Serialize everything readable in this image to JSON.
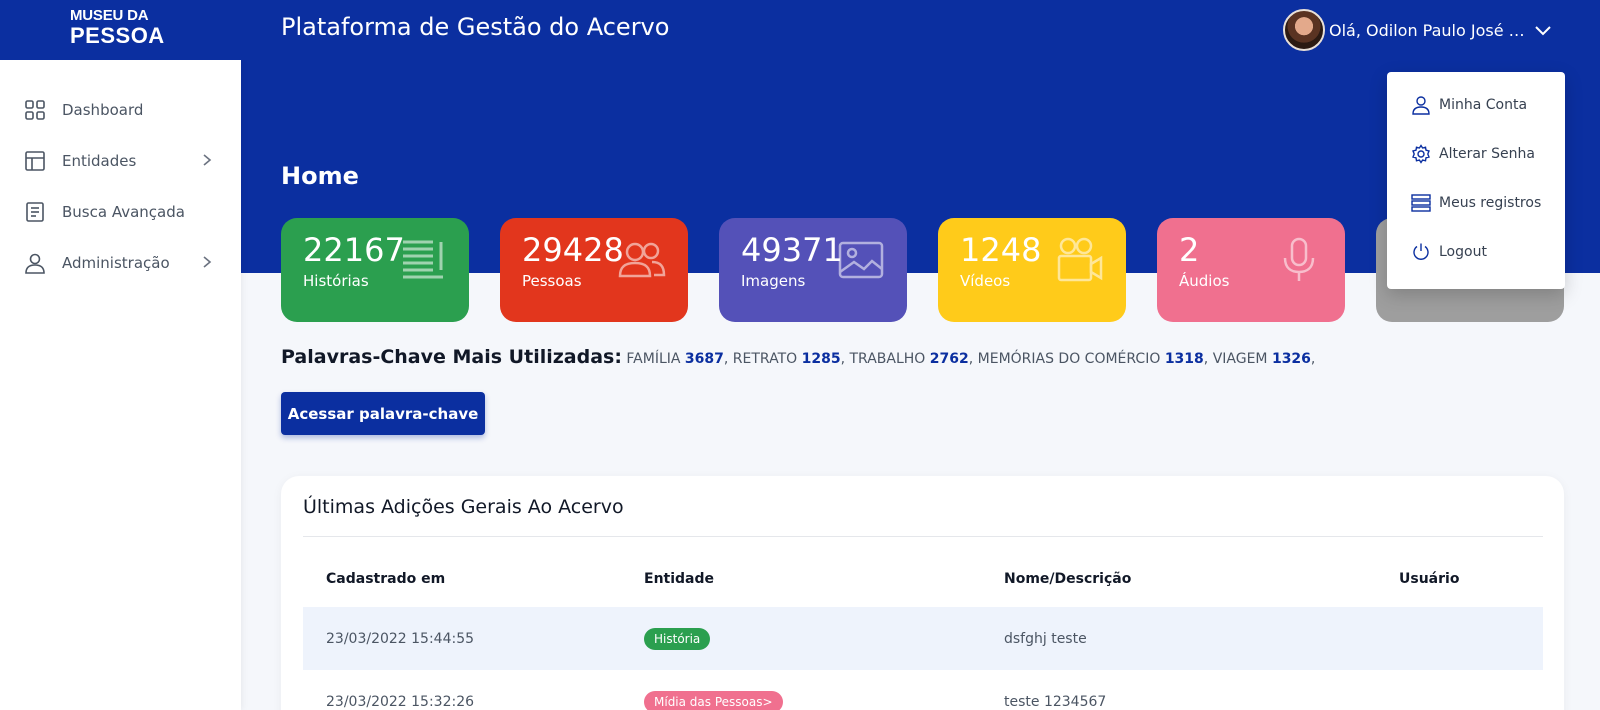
{
  "header": {
    "logo_line1": "MUSEU DA",
    "logo_line2": "PESSOA",
    "app_title": "Plataforma de Gestão do Acervo",
    "user_greeting": "Olá, Odilon Paulo José M..."
  },
  "sidebar": {
    "items": [
      {
        "label": "Dashboard",
        "icon": "grid-icon"
      },
      {
        "label": "Entidades",
        "icon": "layout-icon"
      },
      {
        "label": "Busca Avançada",
        "icon": "document-icon"
      },
      {
        "label": "Administração",
        "icon": "user-icon"
      }
    ]
  },
  "page": {
    "title": "Home"
  },
  "stats": [
    {
      "value": "22167",
      "label": "Histórias",
      "color": "#2b9f4f",
      "icon": "text-lines-icon"
    },
    {
      "value": "29428",
      "label": "Pessoas",
      "color": "#e2361d",
      "icon": "people-icon"
    },
    {
      "value": "49371",
      "label": "Imagens",
      "color": "#5451b8",
      "icon": "image-icon"
    },
    {
      "value": "1248",
      "label": "Vídeos",
      "color": "#ffcb1a",
      "icon": "video-camera-icon"
    },
    {
      "value": "2",
      "label": "Áudios",
      "color": "#f0708f",
      "icon": "microphone-icon"
    },
    {
      "value": "",
      "label": "",
      "color": "#9e9e9e",
      "icon": ""
    }
  ],
  "keywords": {
    "title": "Palavras-Chave Mais Utilizadas:",
    "items": [
      {
        "word": "FAMÍLIA",
        "count": "3687"
      },
      {
        "word": "RETRATO",
        "count": "1285"
      },
      {
        "word": "TRABALHO",
        "count": "2762"
      },
      {
        "word": "MEMÓRIAS DO COMÉRCIO",
        "count": "1318"
      },
      {
        "word": "VIAGEM",
        "count": "1326"
      }
    ],
    "button_label": "Acessar palavra-chave"
  },
  "recent": {
    "title": "Últimas Adições Gerais Ao Acervo",
    "columns": [
      "Cadastrado em",
      "Entidade",
      "Nome/Descrição",
      "Usuário"
    ],
    "rows": [
      {
        "date": "23/03/2022 15:44:55",
        "entity": "História",
        "entity_color": "#2b9f4f",
        "name": "dsfghj teste",
        "user": ""
      },
      {
        "date": "23/03/2022 15:32:26",
        "entity": "Mídia das Pessoas>",
        "entity_color": "#f0708f",
        "name": "teste 1234567",
        "user": ""
      }
    ]
  },
  "user_menu": {
    "items": [
      {
        "label": "Minha Conta",
        "icon": "user-icon"
      },
      {
        "label": "Alterar Senha",
        "icon": "gear-icon"
      },
      {
        "label": "Meus registros",
        "icon": "list-icon"
      },
      {
        "label": "Logout",
        "icon": "power-icon"
      }
    ]
  },
  "colors": {
    "brand": "#0b2fa0",
    "background": "#f5f7fb"
  }
}
